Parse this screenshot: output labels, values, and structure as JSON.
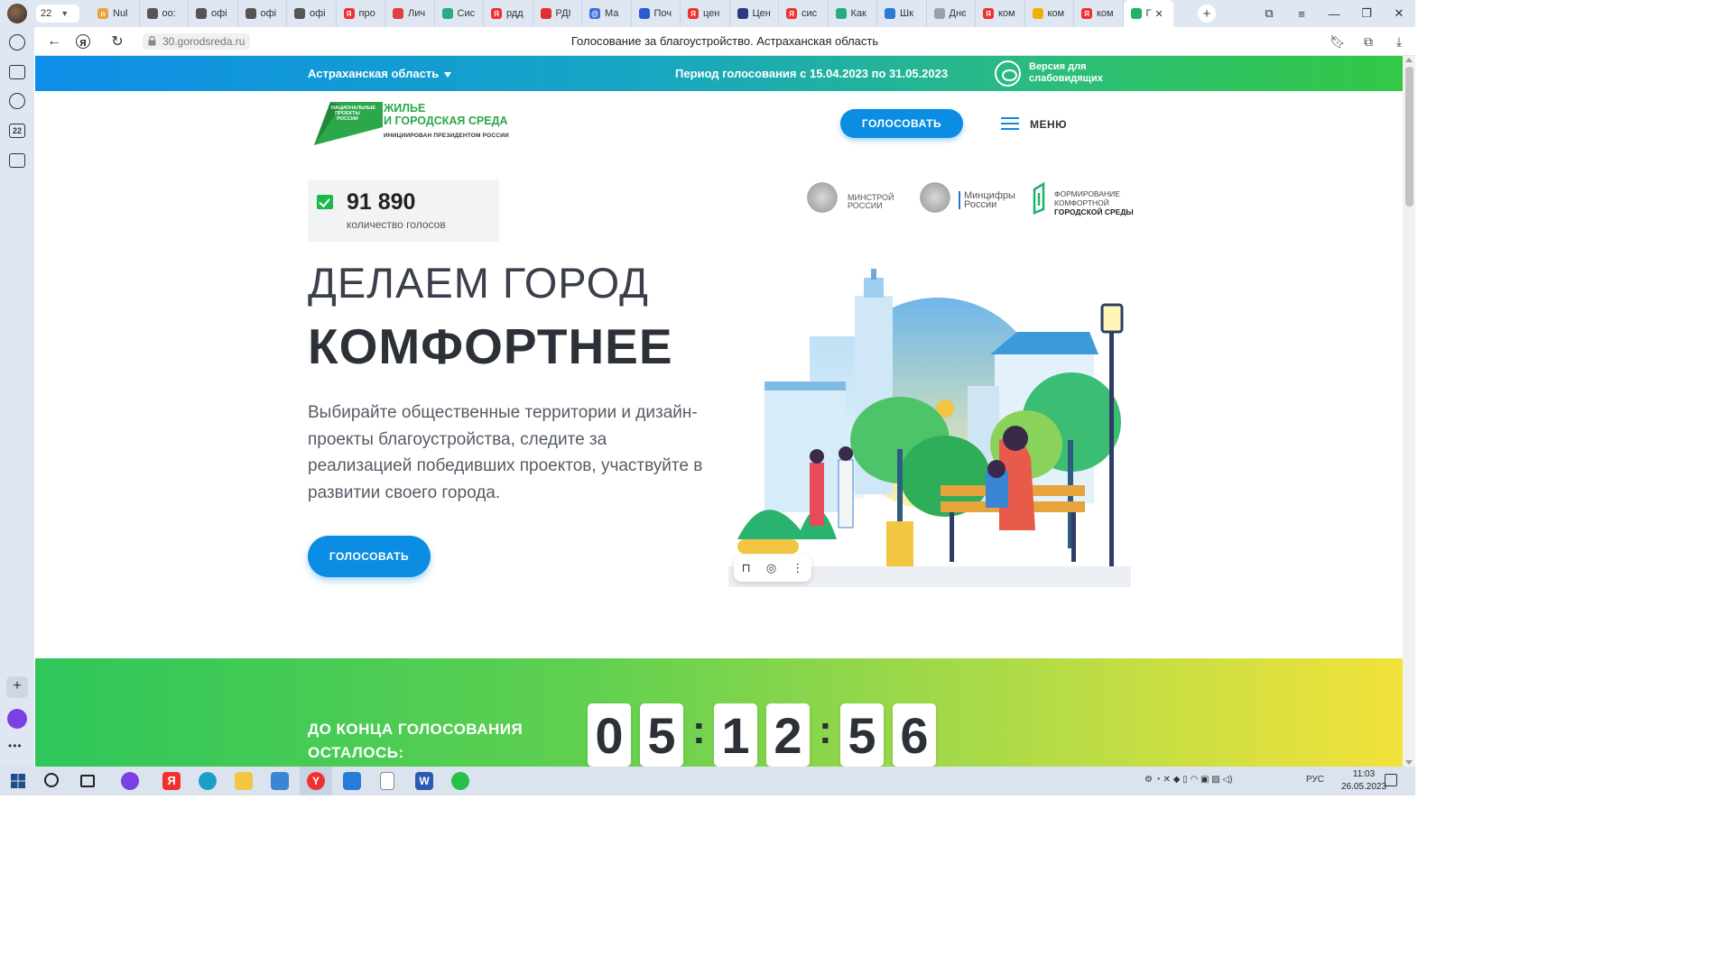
{
  "browser": {
    "tab_counter": "22",
    "tabs": [
      {
        "label": "Nul",
        "color": "#e8a33c",
        "glyph": "n"
      },
      {
        "label": "оо:",
        "color": "#555555",
        "glyph": ""
      },
      {
        "label": "офі",
        "color": "#555555",
        "glyph": ""
      },
      {
        "label": "офі",
        "color": "#555555",
        "glyph": ""
      },
      {
        "label": "офі",
        "color": "#555555",
        "glyph": ""
      },
      {
        "label": "про",
        "color": "#f33030",
        "glyph": "Я"
      },
      {
        "label": "Лич",
        "color": "#e04040",
        "glyph": ""
      },
      {
        "label": "Сис",
        "color": "#2aaa80",
        "glyph": ""
      },
      {
        "label": "рдд",
        "color": "#f33030",
        "glyph": "Я"
      },
      {
        "label": "РДІ",
        "color": "#e03030",
        "glyph": ""
      },
      {
        "label": "Ма",
        "color": "#3b6fd8",
        "glyph": "@"
      },
      {
        "label": "Поч",
        "color": "#2a5bd0",
        "glyph": ""
      },
      {
        "label": "цен",
        "color": "#f33030",
        "glyph": "Я"
      },
      {
        "label": "Цен",
        "color": "#2b3a80",
        "glyph": ""
      },
      {
        "label": "сис",
        "color": "#f33030",
        "glyph": "Я"
      },
      {
        "label": "Как",
        "color": "#2aaa80",
        "glyph": ""
      },
      {
        "label": "Шк",
        "color": "#2a7ad8",
        "glyph": ""
      },
      {
        "label": "Днє",
        "color": "#9aa0aa",
        "glyph": ""
      },
      {
        "label": "ком",
        "color": "#f33030",
        "glyph": "Я"
      },
      {
        "label": "ком",
        "color": "#f0b000",
        "glyph": ""
      },
      {
        "label": "ком",
        "color": "#f33030",
        "glyph": "Я"
      },
      {
        "label": "Г",
        "color": "#1fb06a",
        "glyph": "",
        "active": true
      }
    ],
    "url": "30.gorodsreda.ru",
    "page_title": "Голосование за благоустройство. Астраханская область"
  },
  "site": {
    "region": "Астраханская область",
    "period": "Период голосования с 15.04.2023 по 31.05.2023",
    "accessibility": "Версия для слабовидящих",
    "logo": {
      "np": "НАЦИОНАЛЬНЫЕ ПРОЕКТЫ РОССИИ",
      "line1": "ЖИЛЬЕ",
      "line2": "И ГОРОДСКАЯ СРЕДА",
      "line3": "ИНИЦИИРОВАН ПРЕЗИДЕНТОМ РОССИИ"
    },
    "vote_button": "ГОЛОСОВАТЬ",
    "menu_label": "МЕНЮ",
    "votes_count": "91 890",
    "votes_label": "количество голосов",
    "partners": {
      "minstroy": "МИНСТРОЙ РОССИИ",
      "mincifry": "Минцифры России",
      "fkgs_1": "ФОРМИРОВАНИЕ",
      "fkgs_2": "КОМФОРТНОЙ",
      "fkgs_3": "ГОРОДСКОЙ СРЕДЫ"
    },
    "hero_line1": "ДЕЛАЕМ ГОРОД",
    "hero_line2": "КОМФОРТНЕЕ",
    "hero_desc": "Выбирайте общественные территории и дизайн-проекты благоустройства, следите за реализацией победивших проектов, участвуйте в развитии своего города.",
    "countdown_label": "ДО КОНЦА ГОЛОСОВАНИЯ ОСТАЛОСЬ:",
    "countdown_digits": [
      "0",
      "5",
      "1",
      "2",
      "5",
      "6"
    ]
  },
  "taskbar": {
    "lang": "РУС",
    "time": "11:03",
    "date": "26.05.2023"
  },
  "colors": {
    "brand_blue": "#0a8de3",
    "brand_green": "#2aa84a",
    "strip_gradient_start": "#0d8ee8",
    "strip_gradient_end": "#33c845"
  }
}
